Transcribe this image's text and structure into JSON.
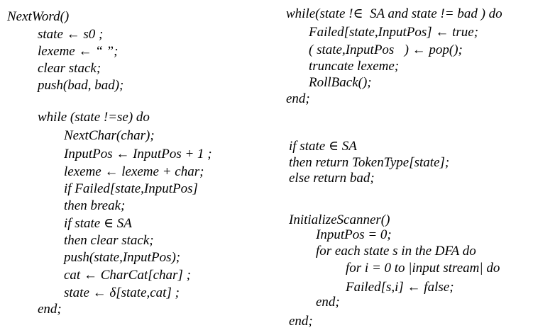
{
  "left_column": {
    "lines": [
      "NextWord()",
      "state ← s0 ;",
      "lexeme ← “ ”;",
      "clear stack;",
      "push(bad, bad);",
      "while (state !=se) do",
      "NextChar(char);",
      "InputPos ← InputPos + 1 ;",
      "lexeme ← lexeme + char;",
      "if Failed[state,InputPos]",
      "then break;",
      "if state ∈ SA",
      "then clear stack;",
      "push(state,InputPos);",
      "cat ← CharCat[char] ;",
      "state ← δ[state,cat] ;",
      "end;"
    ]
  },
  "right_column": {
    "lines": [
      "while(state !∈  SA and state != bad ) do",
      "Failed[state,InputPos] ← true;",
      "( state,InputPos   ) ← pop();",
      "truncate lexeme;",
      "RollBack();",
      "end;",
      "if state ∈ SA",
      "then return TokenType[state];",
      "else return bad;",
      "InitializeScanner()",
      "InputPos = 0;",
      "for each state s in the DFA do",
      "for i = 0 to |input stream| do",
      "Failed[s,i] ← false;",
      "end;",
      "end;"
    ]
  }
}
